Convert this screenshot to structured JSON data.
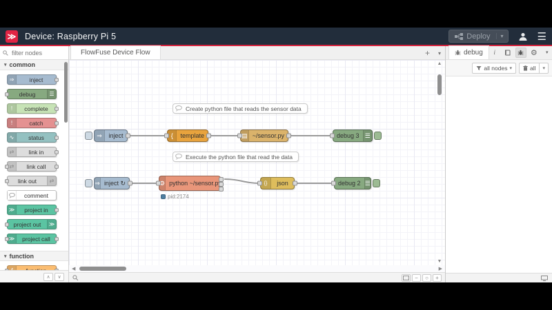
{
  "header": {
    "title": "Device: Raspberry Pi 5",
    "deploy": "Deploy"
  },
  "palette": {
    "filter_placeholder": "filter nodes",
    "categories": [
      {
        "label": "common"
      },
      {
        "label": "function"
      }
    ],
    "items": {
      "inject": "inject",
      "debug": "debug",
      "complete": "complete",
      "catch": "catch",
      "status": "status",
      "link_in": "link in",
      "link_call": "link call",
      "link_out": "link out",
      "comment": "comment",
      "project_in": "project in",
      "project_out": "project out",
      "project_call": "project call",
      "function": "function"
    }
  },
  "workspace": {
    "tab": "FlowFuse Device Flow",
    "comment1": "Create python file that reads the sensor data",
    "comment2": "Execute the python file that read the data",
    "nodes": {
      "inject1": "inject",
      "template": "template",
      "file": "~/sensor.py",
      "debug3": "debug 3",
      "inject2": "inject ↻",
      "exec": "python ~/sensor.py",
      "json": "json",
      "debug2": "debug 2"
    },
    "status": {
      "exec_pid": "pid:2174"
    }
  },
  "sidebar": {
    "tab": "debug",
    "filter_nodes": "all nodes",
    "filter_all": "all"
  },
  "icons": {
    "plus": "+",
    "caret": "▾",
    "menu": "☰",
    "gear": "⚙",
    "info": "i",
    "collapse_up": "∧",
    "collapse_down": "∨",
    "left": "◀",
    "right": "▶",
    "up": "▲",
    "down": "▼",
    "minus": "−",
    "circle": "○",
    "category_chevron": "▾",
    "logo_glyph": "≫"
  },
  "node_icons": {
    "inject": "⇒",
    "debug": "☰",
    "complete": "!",
    "catch": "!",
    "status": "∿",
    "link": "⇄",
    "function": "ƒ",
    "template": "{",
    "file": "▤",
    "exec": "⚙",
    "json": "{}",
    "project": "≫"
  },
  "colors": {
    "accent_red": "#d5243e",
    "header_bg": "#222d3b",
    "node_inject": "#a6bbcf",
    "node_debug": "#87a980",
    "node_complete": "#c7e3b6",
    "node_catch": "#e49191",
    "node_status": "#94c1c1",
    "node_link": "#dddddd",
    "node_project": "#5bc4a2",
    "node_function": "#fbbd71",
    "node_template": "#e8a33d",
    "node_file": "#dbb36b",
    "node_exec": "#e9967a",
    "node_json": "#debd5c",
    "wire": "#999999",
    "status_dot": "#4e7fa2"
  }
}
